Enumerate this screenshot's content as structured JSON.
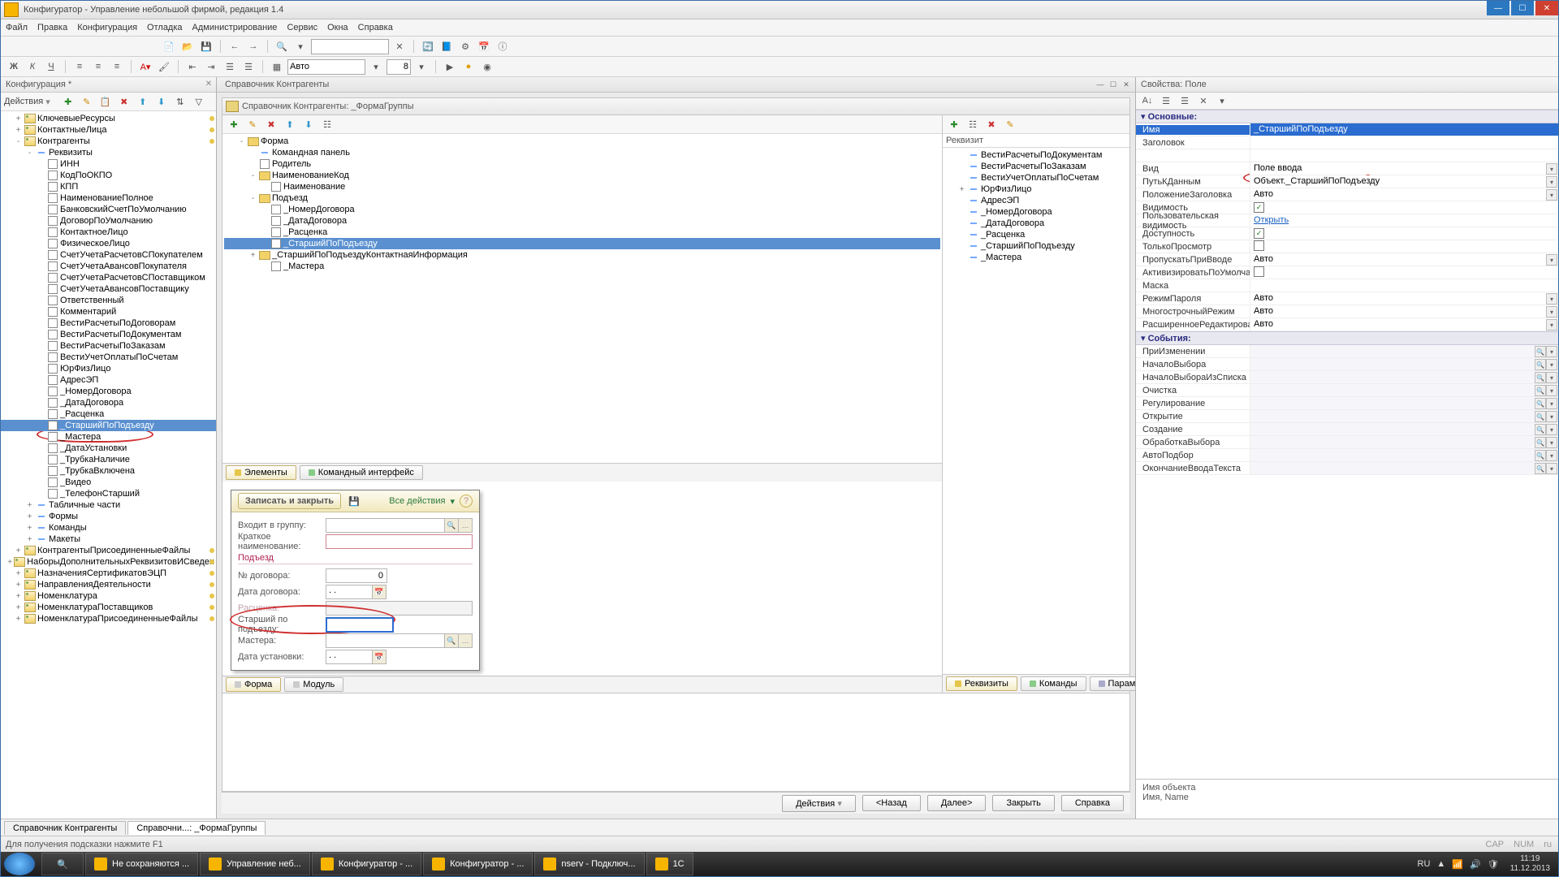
{
  "title": "Конфигуратор - Управление небольшой фирмой, редакция 1.4",
  "menus": [
    "Файл",
    "Правка",
    "Конфигурация",
    "Отладка",
    "Администрирование",
    "Сервис",
    "Окна",
    "Справка"
  ],
  "tb2": {
    "combo1": "Авто",
    "fontsize": "8"
  },
  "left": {
    "title": "Конфигурация *",
    "actions": "Действия",
    "rows": [
      {
        "ind": 1,
        "exp": "+",
        "ico": "ref",
        "t": "КлючевыеРесурсы",
        "mark": 1
      },
      {
        "ind": 1,
        "exp": "+",
        "ico": "ref",
        "t": "КонтактныеЛица",
        "mark": 1
      },
      {
        "ind": 1,
        "exp": "-",
        "ico": "ref",
        "t": "Контрагенты",
        "mark": 1
      },
      {
        "ind": 2,
        "exp": "-",
        "ico": "line",
        "t": "Реквизиты"
      },
      {
        "ind": 3,
        "exp": "",
        "ico": "attr",
        "t": "ИНН"
      },
      {
        "ind": 3,
        "exp": "",
        "ico": "attr",
        "t": "КодПоОКПО"
      },
      {
        "ind": 3,
        "exp": "",
        "ico": "attr",
        "t": "КПП"
      },
      {
        "ind": 3,
        "exp": "",
        "ico": "attr",
        "t": "НаименованиеПолное"
      },
      {
        "ind": 3,
        "exp": "",
        "ico": "attr",
        "t": "БанковскийСчетПоУмолчанию"
      },
      {
        "ind": 3,
        "exp": "",
        "ico": "attr",
        "t": "ДоговорПоУмолчанию"
      },
      {
        "ind": 3,
        "exp": "",
        "ico": "attr",
        "t": "КонтактноеЛицо"
      },
      {
        "ind": 3,
        "exp": "",
        "ico": "attr",
        "t": "ФизическоеЛицо"
      },
      {
        "ind": 3,
        "exp": "",
        "ico": "attr",
        "t": "СчетУчетаРасчетовСПокупателем"
      },
      {
        "ind": 3,
        "exp": "",
        "ico": "attr",
        "t": "СчетУчетаАвансовПокупателя"
      },
      {
        "ind": 3,
        "exp": "",
        "ico": "attr",
        "t": "СчетУчетаРасчетовСПоставщиком"
      },
      {
        "ind": 3,
        "exp": "",
        "ico": "attr",
        "t": "СчетУчетаАвансовПоставщику"
      },
      {
        "ind": 3,
        "exp": "",
        "ico": "attr",
        "t": "Ответственный"
      },
      {
        "ind": 3,
        "exp": "",
        "ico": "attr",
        "t": "Комментарий"
      },
      {
        "ind": 3,
        "exp": "",
        "ico": "attr",
        "t": "ВестиРасчетыПоДоговорам"
      },
      {
        "ind": 3,
        "exp": "",
        "ico": "attr",
        "t": "ВестиРасчетыПоДокументам"
      },
      {
        "ind": 3,
        "exp": "",
        "ico": "attr",
        "t": "ВестиРасчетыПоЗаказам"
      },
      {
        "ind": 3,
        "exp": "",
        "ico": "attr",
        "t": "ВестиУчетОплатыПоСчетам"
      },
      {
        "ind": 3,
        "exp": "",
        "ico": "attr",
        "t": "ЮрФизЛицо"
      },
      {
        "ind": 3,
        "exp": "",
        "ico": "attr",
        "t": "АдресЭП"
      },
      {
        "ind": 3,
        "exp": "",
        "ico": "attr",
        "t": "_НомерДоговора"
      },
      {
        "ind": 3,
        "exp": "",
        "ico": "attr",
        "t": "_ДатаДоговора"
      },
      {
        "ind": 3,
        "exp": "",
        "ico": "attr",
        "t": "_Расценка"
      },
      {
        "ind": 3,
        "exp": "",
        "ico": "attr",
        "t": "_СтаршийПоПодъезду",
        "sel": 1
      },
      {
        "ind": 3,
        "exp": "",
        "ico": "attr",
        "t": "_Мастера"
      },
      {
        "ind": 3,
        "exp": "",
        "ico": "attr",
        "t": "_ДатаУстановки"
      },
      {
        "ind": 3,
        "exp": "",
        "ico": "attr",
        "t": "_ТрубкаНаличие"
      },
      {
        "ind": 3,
        "exp": "",
        "ico": "attr",
        "t": "_ТрубкаВключена"
      },
      {
        "ind": 3,
        "exp": "",
        "ico": "attr",
        "t": "_Видео"
      },
      {
        "ind": 3,
        "exp": "",
        "ico": "attr",
        "t": "_ТелефонСтарший"
      },
      {
        "ind": 2,
        "exp": "+",
        "ico": "line",
        "t": "Табличные части"
      },
      {
        "ind": 2,
        "exp": "+",
        "ico": "line",
        "t": "Формы"
      },
      {
        "ind": 2,
        "exp": "+",
        "ico": "line",
        "t": "Команды"
      },
      {
        "ind": 2,
        "exp": "+",
        "ico": "line",
        "t": "Макеты"
      },
      {
        "ind": 1,
        "exp": "+",
        "ico": "ref",
        "t": "КонтрагентыПрисоединенныеФайлы",
        "mark": 1
      },
      {
        "ind": 1,
        "exp": "+",
        "ico": "ref",
        "t": "НаборыДополнительныхРеквизитовИСведен",
        "mark": 1
      },
      {
        "ind": 1,
        "exp": "+",
        "ico": "ref",
        "t": "НазначенияСертификатовЭЦП",
        "mark": 1
      },
      {
        "ind": 1,
        "exp": "+",
        "ico": "ref",
        "t": "НаправленияДеятельности",
        "mark": 1
      },
      {
        "ind": 1,
        "exp": "+",
        "ico": "ref",
        "t": "Номенклатура",
        "mark": 1
      },
      {
        "ind": 1,
        "exp": "+",
        "ico": "ref",
        "t": "НоменклатураПоставщиков",
        "mark": 1
      },
      {
        "ind": 1,
        "exp": "+",
        "ico": "ref",
        "t": "НоменклатураПрисоединенныеФайлы",
        "mark": 1
      }
    ]
  },
  "center": {
    "mdi_title": "Справочник Контрагенты",
    "fe_title": "Справочник Контрагенты: _ФормаГруппы",
    "struct": [
      {
        "ind": 1,
        "exp": "-",
        "ico": "fold",
        "t": "Форма"
      },
      {
        "ind": 2,
        "exp": "",
        "ico": "line",
        "t": "Командная панель"
      },
      {
        "ind": 2,
        "exp": "",
        "ico": "attr",
        "t": "Родитель"
      },
      {
        "ind": 2,
        "exp": "-",
        "ico": "fold",
        "t": "НаименованиеКод"
      },
      {
        "ind": 3,
        "exp": "",
        "ico": "attr",
        "t": "Наименование"
      },
      {
        "ind": 2,
        "exp": "-",
        "ico": "fold",
        "t": "Подъезд"
      },
      {
        "ind": 3,
        "exp": "",
        "ico": "attr",
        "t": "_НомерДоговора"
      },
      {
        "ind": 3,
        "exp": "",
        "ico": "attr",
        "t": "_ДатаДоговора"
      },
      {
        "ind": 3,
        "exp": "",
        "ico": "attr",
        "t": "_Расценка"
      },
      {
        "ind": 3,
        "exp": "",
        "ico": "attr",
        "t": "_СтаршийПоПодъезду",
        "sel": 1
      },
      {
        "ind": 2,
        "exp": "+",
        "ico": "fold",
        "t": "_СтаршийПоПодъездуКонтактнаяИнформация"
      },
      {
        "ind": 3,
        "exp": "",
        "ico": "attr",
        "t": "_Мастера"
      }
    ],
    "left_tabs": [
      "Элементы",
      "Командный интерфейс"
    ],
    "req": {
      "title": "Реквизит",
      "rows": [
        {
          "ind": 1,
          "t": "ВестиРасчетыПоДокументам"
        },
        {
          "ind": 1,
          "t": "ВестиРасчетыПоЗаказам"
        },
        {
          "ind": 1,
          "t": "ВестиУчетОплатыПоСчетам"
        },
        {
          "ind": 1,
          "t": "ЮрФизЛицо",
          "exp": "+"
        },
        {
          "ind": 1,
          "t": "АдресЭП"
        },
        {
          "ind": 1,
          "t": "_НомерДоговора"
        },
        {
          "ind": 1,
          "t": "_ДатаДоговора"
        },
        {
          "ind": 1,
          "t": "_Расценка"
        },
        {
          "ind": 1,
          "t": "_СтаршийПоПодъезду"
        },
        {
          "ind": 1,
          "t": "_Мастера"
        }
      ],
      "tabs": [
        "Реквизиты",
        "Команды",
        "Параметры"
      ]
    },
    "preview": {
      "save": "Записать и закрыть",
      "allactions": "Все действия",
      "rows": {
        "group": "Входит в группу:",
        "shortname": "Краткое наименование:",
        "pod": "Подъезд",
        "dognum": "№ договора:",
        "dognum_v": "0",
        "dogdate": "Дата договора:",
        "date_v": ".   .",
        "rasc": "Расценка:",
        "senior": "Старший по подъезду:",
        "mast": "Мастера:",
        "inst": "Дата установки:"
      }
    },
    "bottom_tabs": [
      "Форма",
      "Модуль"
    ],
    "wiz": [
      "Действия",
      "<Назад",
      "Далее>",
      "Закрыть",
      "Справка"
    ]
  },
  "props": {
    "title": "Свойства: Поле",
    "cats": {
      "main": "Основные:",
      "events": "События:"
    },
    "rows": [
      {
        "l": "Имя",
        "v": "_СтаршийПоПодъезду",
        "sel": 1
      },
      {
        "l": "Заголовок",
        "v": ""
      },
      {
        "l": "",
        "v": ""
      },
      {
        "l": "Вид",
        "v": "Поле ввода",
        "dd": 1
      },
      {
        "l": "ПутьКДанным",
        "v": "Объект._СтаршийПоПодъезду",
        "dd": 1,
        "circ": 1
      },
      {
        "l": "ПоложениеЗаголовка",
        "v": "Авто",
        "dd": 1
      },
      {
        "l": "Видимость",
        "chk": 1,
        "ck": 1
      },
      {
        "l": "Пользовательская видимость",
        "v": "Открыть",
        "link": 1
      },
      {
        "l": "Доступность",
        "chk": 1,
        "ck": 1
      },
      {
        "l": "ТолькоПросмотр",
        "chk": 1
      },
      {
        "l": "ПропускатьПриВводе",
        "v": "Авто",
        "dd": 1
      },
      {
        "l": "АктивизироватьПоУмолчанию",
        "chk": 1
      },
      {
        "l": "Маска",
        "v": ""
      },
      {
        "l": "РежимПароля",
        "v": "Авто",
        "dd": 1
      },
      {
        "l": "МногострочныйРежим",
        "v": "Авто",
        "dd": 1
      },
      {
        "l": "РасширенноеРедактирование",
        "v": "Авто",
        "dd": 1
      }
    ],
    "events": [
      "ПриИзменении",
      "НачалоВыбора",
      "НачалоВыбораИзСписка",
      "Очистка",
      "Регулирование",
      "Открытие",
      "Создание",
      "ОбработкаВыбора",
      "АвтоПодбор",
      "ОкончаниеВводаТекста"
    ],
    "foot1": "Имя объекта",
    "foot2": "Имя, Name"
  },
  "wtabs": [
    "Справочник Контрагенты",
    "Справочни...: _ФормаГруппы"
  ],
  "status": "Для получения подсказки нажмите F1",
  "caps": [
    "CAP",
    "NUM",
    "ru"
  ],
  "taskbar": {
    "items": [
      "Не сохраняются ...",
      "Управление неб...",
      "Конфигуратор - ...",
      "Конфигуратор - ...",
      "nserv - Подключ...",
      "1С"
    ],
    "lang": "RU",
    "time": "11:19",
    "date": "11.12.2013"
  }
}
